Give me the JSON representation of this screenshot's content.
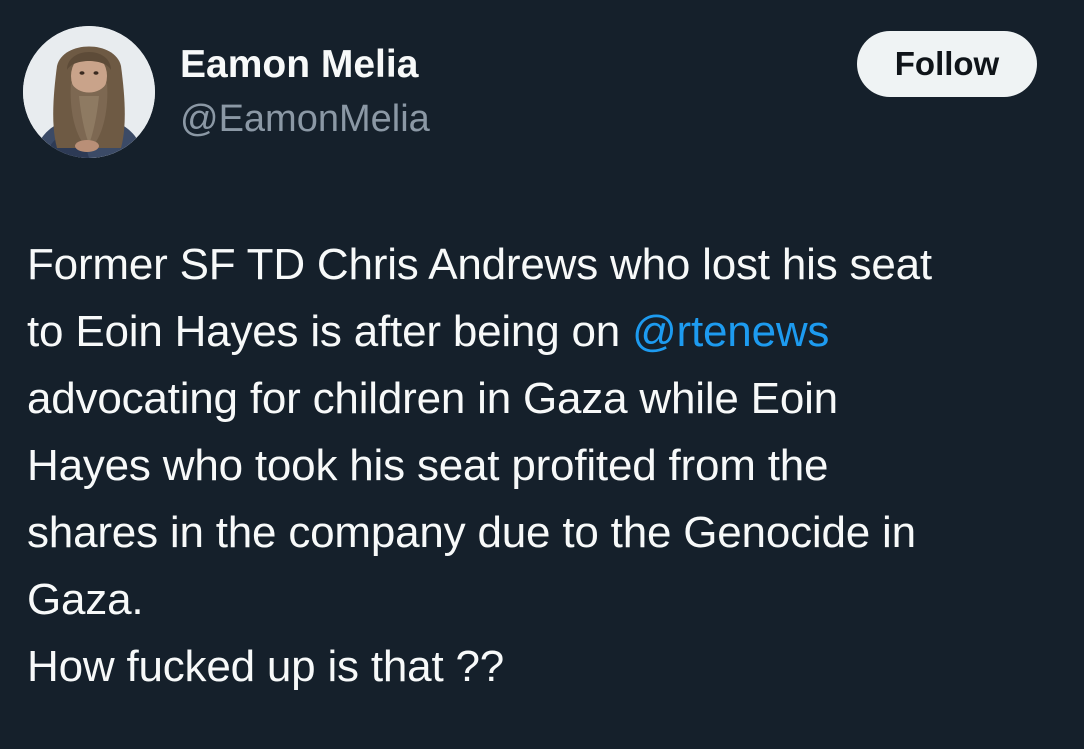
{
  "author": {
    "display_name": "Eamon Melia",
    "handle": "@EamonMelia",
    "avatar_icon": "user-avatar-photo"
  },
  "follow_button": {
    "label": "Follow"
  },
  "tweet": {
    "lines": [
      {
        "segments": [
          {
            "text": "Former SF TD Chris Andrews who lost his seat"
          }
        ]
      },
      {
        "segments": [
          {
            "text": "to Eoin Hayes is after being on "
          },
          {
            "text": "@rtenews",
            "mention": true
          }
        ]
      },
      {
        "segments": [
          {
            "text": "advocating for children in Gaza while Eoin"
          }
        ]
      },
      {
        "segments": [
          {
            "text": "Hayes who took his seat profited from the"
          }
        ]
      },
      {
        "segments": [
          {
            "text": "shares in the company due to the Genocide in"
          }
        ]
      },
      {
        "segments": [
          {
            "text": "Gaza."
          }
        ]
      },
      {
        "segments": [
          {
            "text": "How fucked up is that ??"
          }
        ]
      }
    ]
  },
  "colors": {
    "background": "#15202b",
    "text_primary": "#f7f9f9",
    "text_secondary": "#8b98a5",
    "mention": "#1d9bf0",
    "follow_bg": "#eff3f4",
    "follow_text": "#0f1419"
  }
}
